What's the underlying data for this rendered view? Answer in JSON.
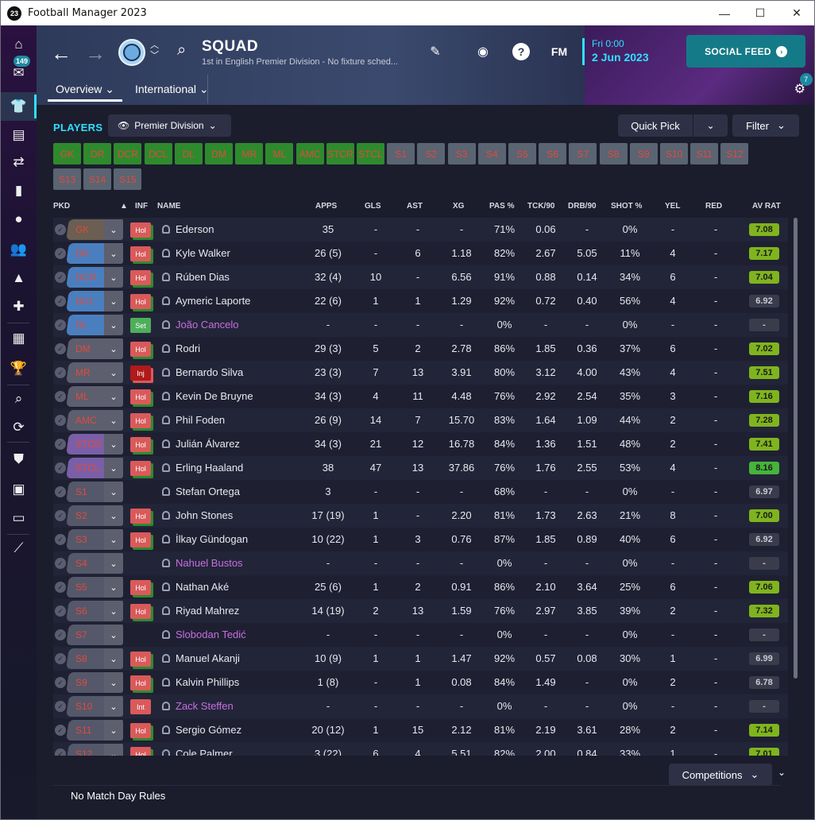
{
  "window": {
    "title": "Football Manager 2023",
    "app_icon": "23",
    "minimize": "—",
    "maximize": "☐",
    "close": "✕"
  },
  "sidebar": {
    "inbox_badge": "149"
  },
  "header": {
    "title": "SQUAD",
    "subtitle": "1st in English Premier Division - No fixture sched...",
    "date_time": "Fri 0:00",
    "date_day": "2 Jun 2023",
    "fm_label": "FM",
    "help_label": "?",
    "social_feed": "SOCIAL FEED",
    "notif_badge": "7",
    "tabs": [
      {
        "label": "Overview ⌄"
      },
      {
        "label": "International ⌄"
      }
    ]
  },
  "toolbar": {
    "players_label": "PLAYERS",
    "division": "Premier Division",
    "quick_pick": "Quick Pick",
    "filter": "Filter"
  },
  "position_buttons": [
    "GK",
    "DR",
    "DCR",
    "DCL",
    "DL",
    "DM",
    "MR",
    "ML",
    "AMC",
    "STCR",
    "STCL",
    "S1",
    "S2",
    "S3",
    "S4",
    "S5",
    "S6",
    "S7",
    "S8",
    "S9",
    "S10",
    "S11",
    "S12",
    "S13",
    "S14",
    "S15"
  ],
  "table": {
    "headers": {
      "pkd": "PKD",
      "inf": "INF",
      "name": "NAME",
      "apps": "APPS",
      "gls": "GLS",
      "ast": "AST",
      "xg": "XG",
      "pas": "PAS %",
      "tck": "TCK/90",
      "drb": "DRB/90",
      "shot": "SHOT %",
      "yel": "YEL",
      "red": "RED",
      "avrat": "AV RAT"
    },
    "rows": [
      {
        "pos": "GK",
        "inf": "Hol",
        "name": "Ederson",
        "apps": "35",
        "gls": "-",
        "ast": "-",
        "xg": "-",
        "pas": "71%",
        "tck": "0.06",
        "drb": "-",
        "shot": "0%",
        "yel": "-",
        "red": "-",
        "rat": "7.08"
      },
      {
        "pos": "DR",
        "inf": "Hol",
        "name": "Kyle Walker",
        "apps": "26 (5)",
        "gls": "-",
        "ast": "6",
        "xg": "1.18",
        "pas": "82%",
        "tck": "2.67",
        "drb": "5.05",
        "shot": "11%",
        "yel": "4",
        "red": "-",
        "rat": "7.17"
      },
      {
        "pos": "DCR",
        "inf": "Hol",
        "name": "Rúben Dias",
        "apps": "32 (4)",
        "gls": "10",
        "ast": "-",
        "xg": "6.56",
        "pas": "91%",
        "tck": "0.88",
        "drb": "0.14",
        "shot": "34%",
        "yel": "6",
        "red": "-",
        "rat": "7.04"
      },
      {
        "pos": "DCL",
        "inf": "Hol",
        "name": "Aymeric Laporte",
        "apps": "22 (6)",
        "gls": "1",
        "ast": "1",
        "xg": "1.29",
        "pas": "92%",
        "tck": "0.72",
        "drb": "0.40",
        "shot": "56%",
        "yel": "4",
        "red": "-",
        "rat": "6.92"
      },
      {
        "pos": "DL",
        "inf": "Set",
        "name": "João Cancelo",
        "apps": "-",
        "gls": "-",
        "ast": "-",
        "xg": "-",
        "pas": "0%",
        "tck": "-",
        "drb": "-",
        "shot": "0%",
        "yel": "-",
        "red": "-",
        "rat": "-"
      },
      {
        "pos": "DM",
        "inf": "Hol",
        "name": "Rodri",
        "apps": "29 (3)",
        "gls": "5",
        "ast": "2",
        "xg": "2.78",
        "pas": "86%",
        "tck": "1.85",
        "drb": "0.36",
        "shot": "37%",
        "yel": "6",
        "red": "-",
        "rat": "7.02"
      },
      {
        "pos": "MR",
        "inf": "Inj",
        "name": "Bernardo Silva",
        "apps": "23 (3)",
        "gls": "7",
        "ast": "13",
        "xg": "3.91",
        "pas": "80%",
        "tck": "3.12",
        "drb": "4.00",
        "shot": "43%",
        "yel": "4",
        "red": "-",
        "rat": "7.51"
      },
      {
        "pos": "ML",
        "inf": "Hol",
        "name": "Kevin De Bruyne",
        "apps": "34 (3)",
        "gls": "4",
        "ast": "11",
        "xg": "4.48",
        "pas": "76%",
        "tck": "2.92",
        "drb": "2.54",
        "shot": "35%",
        "yel": "3",
        "red": "-",
        "rat": "7.16"
      },
      {
        "pos": "AMC",
        "inf": "Hol",
        "name": "Phil Foden",
        "apps": "26 (9)",
        "gls": "14",
        "ast": "7",
        "xg": "15.70",
        "pas": "83%",
        "tck": "1.64",
        "drb": "1.09",
        "shot": "44%",
        "yel": "2",
        "red": "-",
        "rat": "7.28"
      },
      {
        "pos": "STCR",
        "inf": "Hol",
        "name": "Julián Álvarez",
        "apps": "34 (3)",
        "gls": "21",
        "ast": "12",
        "xg": "16.78",
        "pas": "84%",
        "tck": "1.36",
        "drb": "1.51",
        "shot": "48%",
        "yel": "2",
        "red": "-",
        "rat": "7.41"
      },
      {
        "pos": "STCL",
        "inf": "Hol",
        "name": "Erling Haaland",
        "apps": "38",
        "gls": "47",
        "ast": "13",
        "xg": "37.86",
        "pas": "76%",
        "tck": "1.76",
        "drb": "2.55",
        "shot": "53%",
        "yel": "4",
        "red": "-",
        "rat": "8.16"
      },
      {
        "pos": "S1",
        "inf": "",
        "name": "Stefan Ortega",
        "apps": "3",
        "gls": "-",
        "ast": "-",
        "xg": "-",
        "pas": "68%",
        "tck": "-",
        "drb": "-",
        "shot": "0%",
        "yel": "-",
        "red": "-",
        "rat": "6.97"
      },
      {
        "pos": "S2",
        "inf": "Hol",
        "name": "John Stones",
        "apps": "17 (19)",
        "gls": "1",
        "ast": "-",
        "xg": "2.20",
        "pas": "81%",
        "tck": "1.73",
        "drb": "2.63",
        "shot": "21%",
        "yel": "8",
        "red": "-",
        "rat": "7.00"
      },
      {
        "pos": "S3",
        "inf": "Hol",
        "name": "İlkay Gündogan",
        "apps": "10 (22)",
        "gls": "1",
        "ast": "3",
        "xg": "0.76",
        "pas": "87%",
        "tck": "1.85",
        "drb": "0.89",
        "shot": "40%",
        "yel": "6",
        "red": "-",
        "rat": "6.92"
      },
      {
        "pos": "S4",
        "inf": "",
        "name": "Nahuel Bustos",
        "apps": "-",
        "gls": "-",
        "ast": "-",
        "xg": "-",
        "pas": "0%",
        "tck": "-",
        "drb": "-",
        "shot": "0%",
        "yel": "-",
        "red": "-",
        "rat": "-"
      },
      {
        "pos": "S5",
        "inf": "Hol",
        "name": "Nathan Aké",
        "apps": "25 (6)",
        "gls": "1",
        "ast": "2",
        "xg": "0.91",
        "pas": "86%",
        "tck": "2.10",
        "drb": "3.64",
        "shot": "25%",
        "yel": "6",
        "red": "-",
        "rat": "7.06"
      },
      {
        "pos": "S6",
        "inf": "Hol",
        "name": "Riyad Mahrez",
        "apps": "14 (19)",
        "gls": "2",
        "ast": "13",
        "xg": "1.59",
        "pas": "76%",
        "tck": "2.97",
        "drb": "3.85",
        "shot": "39%",
        "yel": "2",
        "red": "-",
        "rat": "7.32"
      },
      {
        "pos": "S7",
        "inf": "",
        "name": "Slobodan Tedić",
        "apps": "-",
        "gls": "-",
        "ast": "-",
        "xg": "-",
        "pas": "0%",
        "tck": "-",
        "drb": "-",
        "shot": "0%",
        "yel": "-",
        "red": "-",
        "rat": "-"
      },
      {
        "pos": "S8",
        "inf": "Hol",
        "name": "Manuel Akanji",
        "apps": "10 (9)",
        "gls": "1",
        "ast": "1",
        "xg": "1.47",
        "pas": "92%",
        "tck": "0.57",
        "drb": "0.08",
        "shot": "30%",
        "yel": "1",
        "red": "-",
        "rat": "6.99"
      },
      {
        "pos": "S9",
        "inf": "Hol",
        "name": "Kalvin Phillips",
        "apps": "1 (8)",
        "gls": "-",
        "ast": "1",
        "xg": "0.08",
        "pas": "84%",
        "tck": "1.49",
        "drb": "-",
        "shot": "0%",
        "yel": "2",
        "red": "-",
        "rat": "6.78"
      },
      {
        "pos": "S10",
        "inf": "Int",
        "name": "Zack Steffen",
        "apps": "-",
        "gls": "-",
        "ast": "-",
        "xg": "-",
        "pas": "0%",
        "tck": "-",
        "drb": "-",
        "shot": "0%",
        "yel": "-",
        "red": "-",
        "rat": "-"
      },
      {
        "pos": "S11",
        "inf": "Hol",
        "name": "Sergio Gómez",
        "apps": "20 (12)",
        "gls": "1",
        "ast": "15",
        "xg": "2.12",
        "pas": "81%",
        "tck": "2.19",
        "drb": "3.61",
        "shot": "28%",
        "yel": "2",
        "red": "-",
        "rat": "7.14"
      },
      {
        "pos": "S12",
        "inf": "Hol",
        "name": "Cole Palmer",
        "apps": "3 (22)",
        "gls": "6",
        "ast": "4",
        "xg": "5.51",
        "pas": "82%",
        "tck": "2.00",
        "drb": "0.84",
        "shot": "33%",
        "yel": "1",
        "red": "-",
        "rat": "7.01"
      }
    ]
  },
  "footer": {
    "competitions": "Competitions",
    "match_day_rules": "No Match Day Rules"
  }
}
